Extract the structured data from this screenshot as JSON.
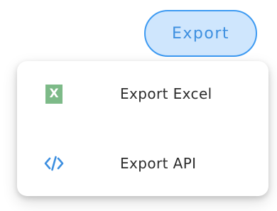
{
  "export_button": {
    "label": "Export"
  },
  "menu": {
    "items": [
      {
        "label": "Export Excel",
        "icon": "excel-icon",
        "icon_glyph": "X",
        "icon_color": "#7dba88"
      },
      {
        "label": "Export API",
        "icon": "code-icon",
        "icon_color": "#3d8fe0"
      }
    ]
  },
  "colors": {
    "accent": "#3d9af2",
    "button_fill": "#cfe6fd",
    "text": "#2c2c2c"
  }
}
